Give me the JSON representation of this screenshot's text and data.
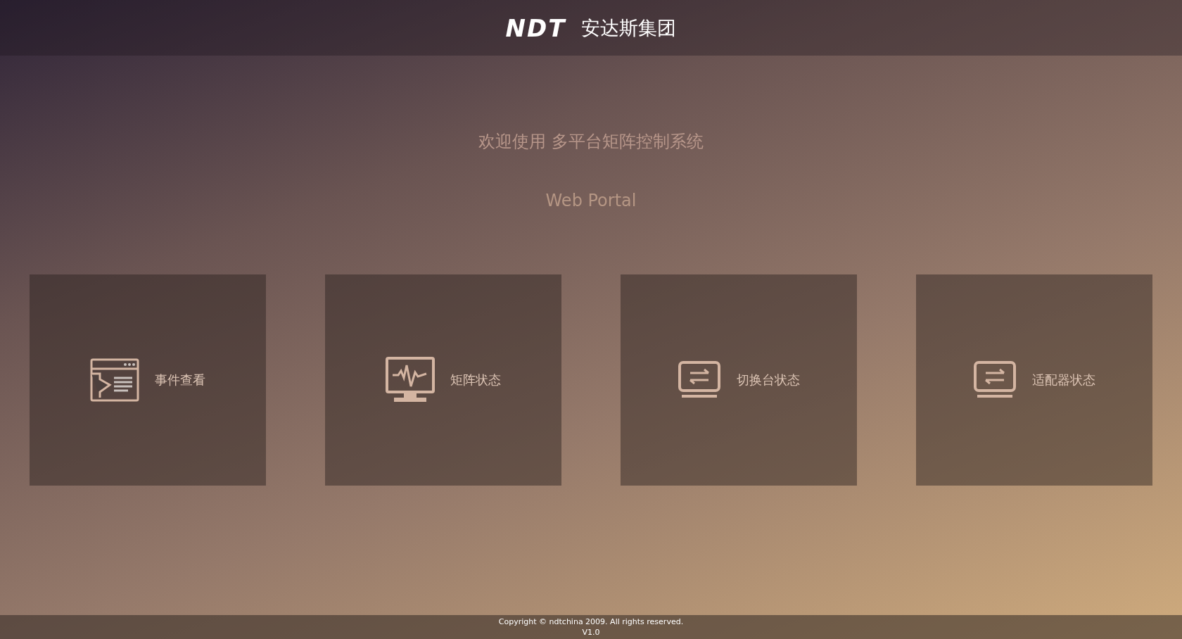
{
  "header": {
    "logo": "NDT",
    "company": "安达斯集团"
  },
  "welcome": "欢迎使用 多平台矩阵控制系统",
  "subtitle": "Web Portal",
  "tiles": [
    {
      "kind": "events",
      "label": "事件查看"
    },
    {
      "kind": "monitor",
      "label": "矩阵状态"
    },
    {
      "kind": "switch",
      "label": "切换台状态"
    },
    {
      "kind": "switch",
      "label": "适配器状态"
    }
  ],
  "footer": {
    "copyright": "Copyright © ndtchina 2009. All rights reserved.",
    "version": "V1.0"
  }
}
